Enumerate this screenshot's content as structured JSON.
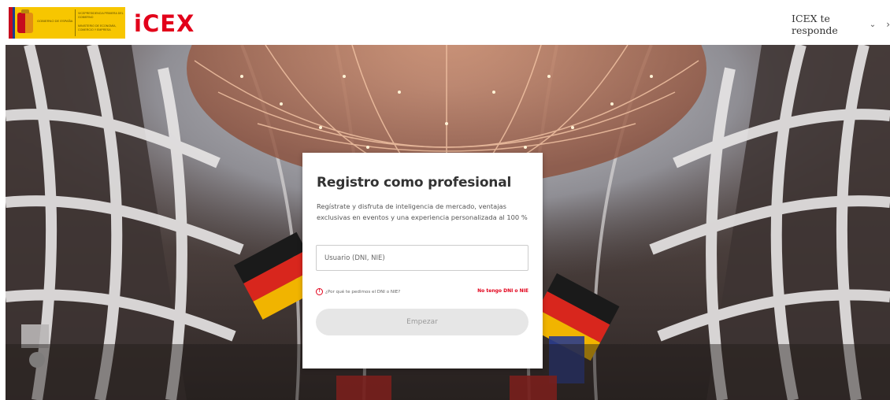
{
  "header": {
    "gov_logo": {
      "left_text": "Gobierno de España",
      "right_top_text": "Vicepresidencia Primera del Gobierno",
      "right_bottom_text": "Ministerio de Economía, Comercio y Empresa"
    },
    "brand": "iCEX",
    "help_menu_label": "ICEX te responde"
  },
  "card": {
    "title": "Registro como profesional",
    "description": "Regístrate y disfruta de inteligencia de mercado, ventajas exclusivas en eventos y una experiencia personalizada al 100 %",
    "user_input": {
      "placeholder": "Usuario (DNI, NIE)",
      "value": ""
    },
    "why_link": "¿Por qué te pedimos el DNI o NIE?",
    "no_dni_link": "No tengo DNI o NIE",
    "start_button": "Empezar"
  },
  "icons": {
    "help_menu": "chevron-down-icon",
    "header_right": "chevron-right-icon",
    "why_link": "info-icon"
  },
  "colors": {
    "brand_red": "#e2001a",
    "gov_yellow": "#f7c600",
    "button_disabled_bg": "#e6e6e6",
    "button_disabled_text": "#999999"
  }
}
